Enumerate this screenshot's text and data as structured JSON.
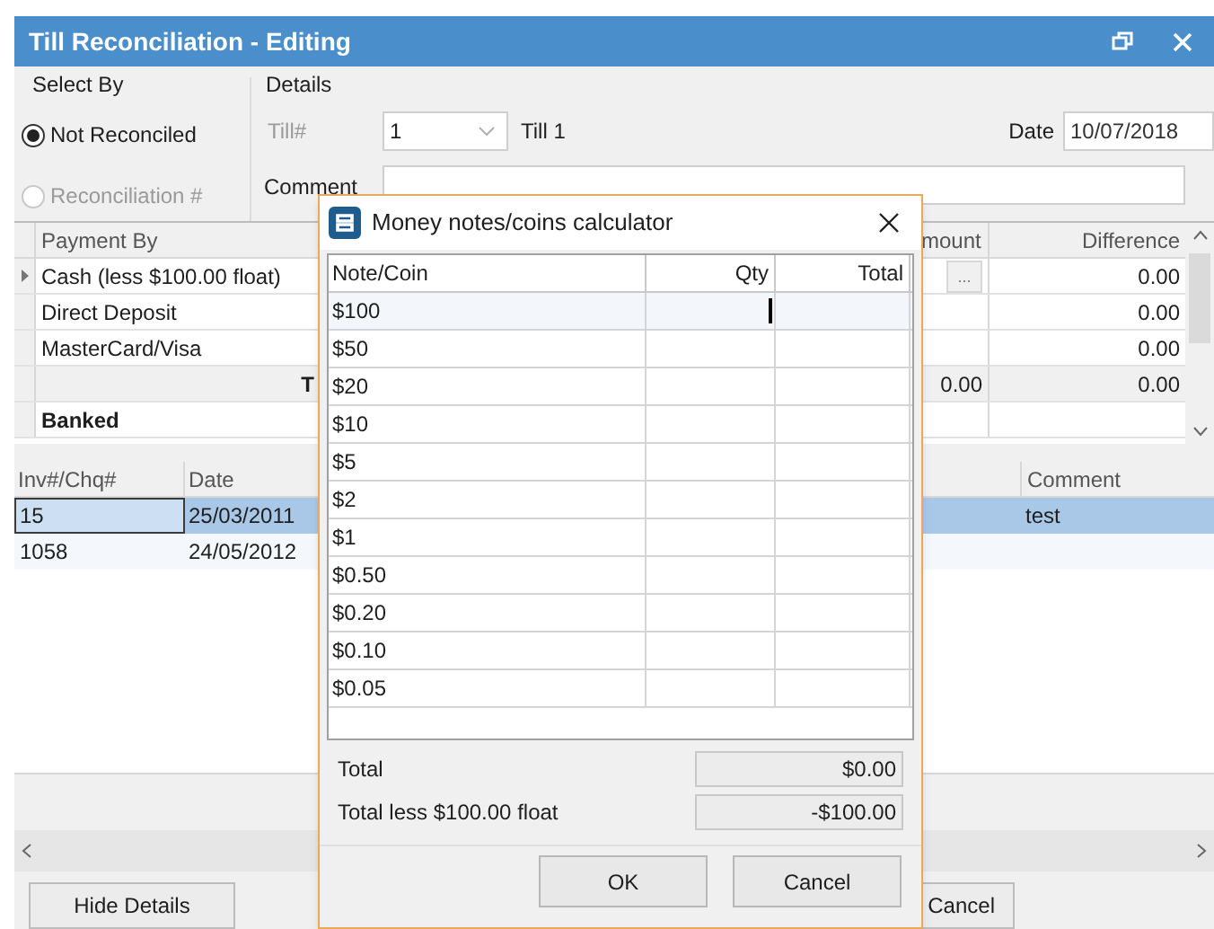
{
  "window": {
    "title": "Till Reconciliation - Editing"
  },
  "select_by": {
    "title": "Select By",
    "options": [
      {
        "label": "Not Reconciled",
        "selected": true,
        "disabled": false
      },
      {
        "label": "Reconciliation #",
        "selected": false,
        "disabled": true
      }
    ]
  },
  "details": {
    "title": "Details",
    "till_label": "Till#",
    "till_value": "1",
    "till_name": "Till 1",
    "date_label": "Date",
    "date_value": "10/07/2018",
    "comment_label": "Comment"
  },
  "payments": {
    "columns": [
      "Payment By",
      "mount",
      "Difference"
    ],
    "rows": [
      {
        "kind": "item",
        "payment_by": "Cash (less $100.00 float)",
        "button": "...",
        "difference": "0.00",
        "current": true
      },
      {
        "kind": "item",
        "payment_by": "Direct Deposit",
        "difference": "0.00",
        "current": false
      },
      {
        "kind": "item",
        "payment_by": "MasterCard/Visa",
        "difference": "0.00",
        "current": false
      },
      {
        "kind": "total",
        "payment_by": "T",
        "amount": "0.00",
        "difference": "0.00",
        "current": false
      },
      {
        "kind": "banked",
        "payment_by": "Banked",
        "current": false
      }
    ]
  },
  "transactions": {
    "columns": [
      "Inv#/Chq#",
      "Date",
      "Comment"
    ],
    "rows": [
      {
        "inv": "15",
        "date": "25/03/2011",
        "comment": "test",
        "selected": true
      },
      {
        "inv": "1058",
        "date": "24/05/2012",
        "selected": false
      }
    ]
  },
  "buttons": {
    "hide_details": "Hide Details",
    "cancel": "Cancel"
  },
  "calculator": {
    "title": "Money notes/coins calculator",
    "columns": [
      "Note/Coin",
      "Qty",
      "Total"
    ],
    "rows": [
      {
        "note": "$100",
        "focused": true
      },
      {
        "note": "$50",
        "focused": false
      },
      {
        "note": "$20",
        "focused": false
      },
      {
        "note": "$10",
        "focused": false
      },
      {
        "note": "$5",
        "focused": false
      },
      {
        "note": "$2",
        "focused": false
      },
      {
        "note": "$1",
        "focused": false
      },
      {
        "note": "$0.50",
        "focused": false
      },
      {
        "note": "$0.20",
        "focused": false
      },
      {
        "note": "$0.10",
        "focused": false
      },
      {
        "note": "$0.05",
        "focused": false
      }
    ],
    "total_label": "Total",
    "total_value": "$0.00",
    "float_label": "Total less $100.00 float",
    "float_value": "-$100.00",
    "buttons": [
      "OK",
      "Cancel"
    ]
  }
}
